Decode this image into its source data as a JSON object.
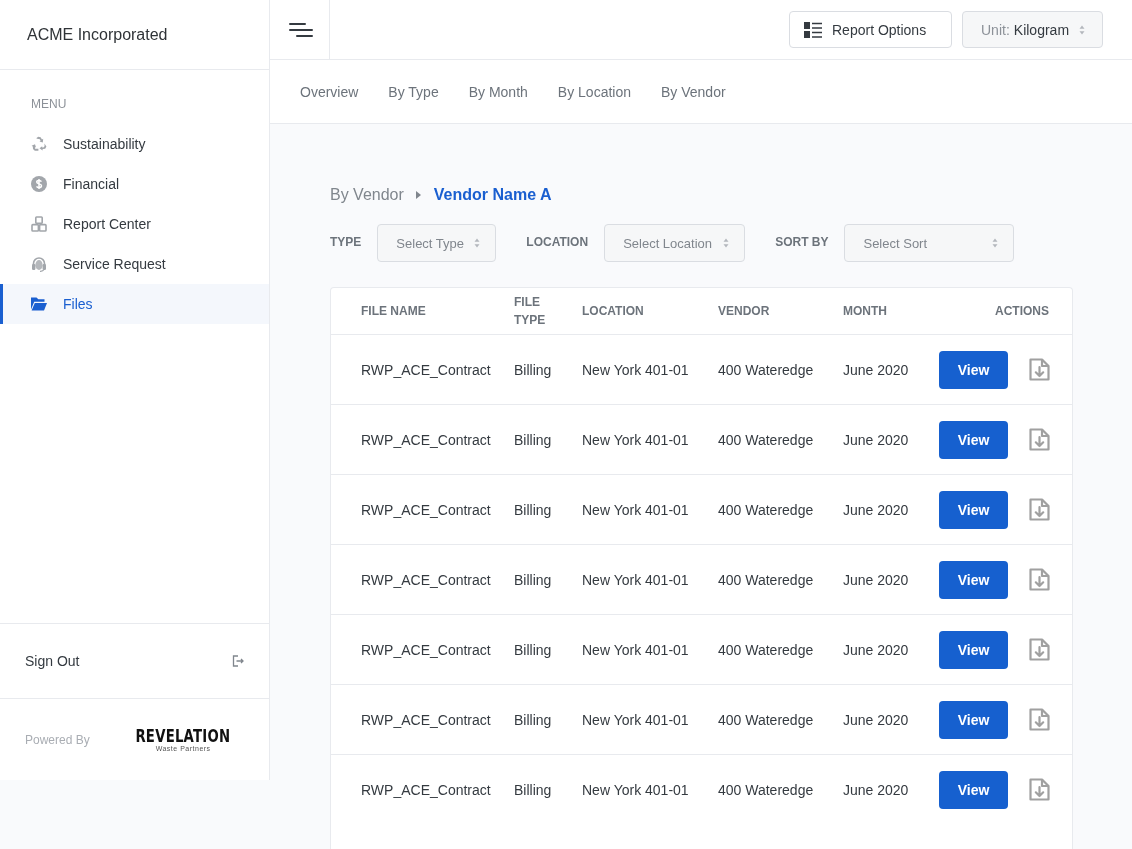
{
  "sidebar": {
    "brand": "ACME Incorporated",
    "menu_heading": "MENU",
    "items": [
      {
        "label": "Sustainability",
        "selected": false
      },
      {
        "label": "Financial",
        "selected": false
      },
      {
        "label": "Report Center",
        "selected": false
      },
      {
        "label": "Service Request",
        "selected": false
      },
      {
        "label": "Files",
        "selected": true
      }
    ],
    "sign_out": "Sign Out",
    "powered_by": "Powered By",
    "logo": {
      "wordmark": "REVELATION",
      "tagline": "Waste Partners"
    }
  },
  "header": {
    "report_options": "Report Options",
    "unit": {
      "label": "Unit:",
      "value": "Kilogram"
    }
  },
  "tabs": [
    {
      "label": "Overview",
      "selected": false
    },
    {
      "label": "By Type",
      "selected": false
    },
    {
      "label": "By Month",
      "selected": false
    },
    {
      "label": "By Location",
      "selected": false
    },
    {
      "label": "By Vendor",
      "selected": false
    }
  ],
  "breadcrumb": {
    "parent": "By Vendor",
    "current": "Vendor Name A"
  },
  "filters": [
    {
      "label": "TYPE",
      "placeholder": "Select Type"
    },
    {
      "label": "LOCATION",
      "placeholder": "Select Location"
    },
    {
      "label": "SORT BY",
      "placeholder": "Select Sort"
    }
  ],
  "table": {
    "columns": [
      "FILE NAME",
      "FILE TYPE",
      "LOCATION",
      "VENDOR",
      "MONTH",
      "ACTIONS"
    ],
    "rows": [
      {
        "file_name": "RWP_ACE_Contract",
        "file_type": "Billing",
        "location": "New York 401-01",
        "vendor": "400 Wateredge",
        "month": "June 2020",
        "action": "View"
      },
      {
        "file_name": "RWP_ACE_Contract",
        "file_type": "Billing",
        "location": "New York 401-01",
        "vendor": "400 Wateredge",
        "month": "June 2020",
        "action": "View"
      },
      {
        "file_name": "RWP_ACE_Contract",
        "file_type": "Billing",
        "location": "New York 401-01",
        "vendor": "400 Wateredge",
        "month": "June 2020",
        "action": "View"
      },
      {
        "file_name": "RWP_ACE_Contract",
        "file_type": "Billing",
        "location": "New York 401-01",
        "vendor": "400 Wateredge",
        "month": "June 2020",
        "action": "View"
      },
      {
        "file_name": "RWP_ACE_Contract",
        "file_type": "Billing",
        "location": "New York 401-01",
        "vendor": "400 Wateredge",
        "month": "June 2020",
        "action": "View"
      },
      {
        "file_name": "RWP_ACE_Contract",
        "file_type": "Billing",
        "location": "New York 401-01",
        "vendor": "400 Wateredge",
        "month": "June 2020",
        "action": "View"
      },
      {
        "file_name": "RWP_ACE_Contract",
        "file_type": "Billing",
        "location": "New York 401-01",
        "vendor": "400 Wateredge",
        "month": "June 2020",
        "action": "View"
      }
    ]
  }
}
